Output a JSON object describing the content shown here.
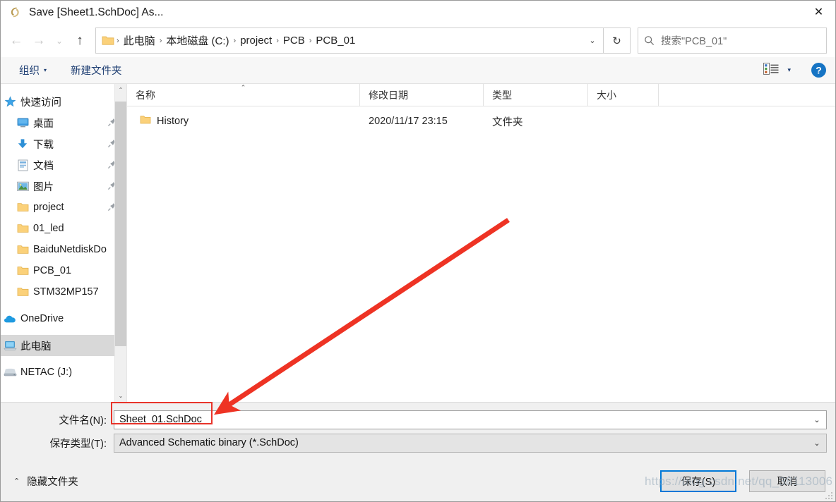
{
  "window": {
    "title": "Save [Sheet1.SchDoc] As...",
    "app_icon": "altium-a-icon",
    "close_label": "✕"
  },
  "nav": {
    "back": "←",
    "forward": "→",
    "recent": "⌄",
    "up": "↑",
    "refresh": "↻",
    "dropdown": "⌄",
    "breadcrumbs": [
      "此电脑",
      "本地磁盘 (C:)",
      "project",
      "PCB",
      "PCB_01"
    ],
    "separator": "›"
  },
  "search": {
    "placeholder": "搜索\"PCB_01\"",
    "icon": "search-icon"
  },
  "toolbar": {
    "organize_label": "组织",
    "organize_caret": "▾",
    "new_folder_label": "新建文件夹",
    "view_caret": "▾",
    "help_label": "?"
  },
  "sidebar": {
    "items": [
      {
        "label": "快速访问",
        "icon": "star-icon",
        "indent": false,
        "pinned": false,
        "selected": false
      },
      {
        "label": "桌面",
        "icon": "desktop-icon",
        "indent": true,
        "pinned": true,
        "selected": false
      },
      {
        "label": "下载",
        "icon": "download-icon",
        "indent": true,
        "pinned": true,
        "selected": false
      },
      {
        "label": "文档",
        "icon": "document-icon",
        "indent": true,
        "pinned": true,
        "selected": false
      },
      {
        "label": "图片",
        "icon": "pictures-icon",
        "indent": true,
        "pinned": true,
        "selected": false
      },
      {
        "label": "project",
        "icon": "folder-icon",
        "indent": true,
        "pinned": true,
        "selected": false
      },
      {
        "label": "01_led",
        "icon": "folder-icon",
        "indent": true,
        "pinned": false,
        "selected": false
      },
      {
        "label": "BaiduNetdiskDo",
        "icon": "folder-icon",
        "indent": true,
        "pinned": false,
        "selected": false
      },
      {
        "label": "PCB_01",
        "icon": "folder-icon",
        "indent": true,
        "pinned": false,
        "selected": false
      },
      {
        "label": "STM32MP157",
        "icon": "folder-icon",
        "indent": true,
        "pinned": false,
        "selected": false
      },
      {
        "label": "OneDrive",
        "icon": "onedrive-icon",
        "indent": false,
        "pinned": false,
        "selected": false
      },
      {
        "label": "此电脑",
        "icon": "this-pc-icon",
        "indent": false,
        "pinned": false,
        "selected": true
      },
      {
        "label": "NETAC (J:)",
        "icon": "drive-icon",
        "indent": false,
        "pinned": false,
        "selected": false
      }
    ],
    "scroll_up": "⌃",
    "scroll_down": "⌄"
  },
  "filelist": {
    "columns": [
      {
        "label": "名称",
        "sorted": true,
        "sort_caret": "⌃"
      },
      {
        "label": "修改日期",
        "sorted": false,
        "sort_caret": ""
      },
      {
        "label": "类型",
        "sorted": false,
        "sort_caret": ""
      },
      {
        "label": "大小",
        "sorted": false,
        "sort_caret": ""
      }
    ],
    "rows": [
      {
        "name": "History",
        "modified": "2020/11/17 23:15",
        "type": "文件夹",
        "size": "",
        "icon": "folder-icon"
      }
    ]
  },
  "form": {
    "filename_label": "文件名(N):",
    "filename_value": "Sheet_01.SchDoc",
    "filetype_label": "保存类型(T):",
    "filetype_value": "Advanced Schematic binary (*.SchDoc)",
    "dropdown_caret": "⌄"
  },
  "footer": {
    "hide_folders_label": "隐藏文件夹",
    "hide_folders_caret": "⌃",
    "save_label": "保存(S)",
    "cancel_label": "取消"
  },
  "annotations": {
    "watermark": "https://blog.csdn.net/qq_38113006",
    "arrow_color": "#ee3324",
    "highlight_box_color": "#e8342a"
  }
}
